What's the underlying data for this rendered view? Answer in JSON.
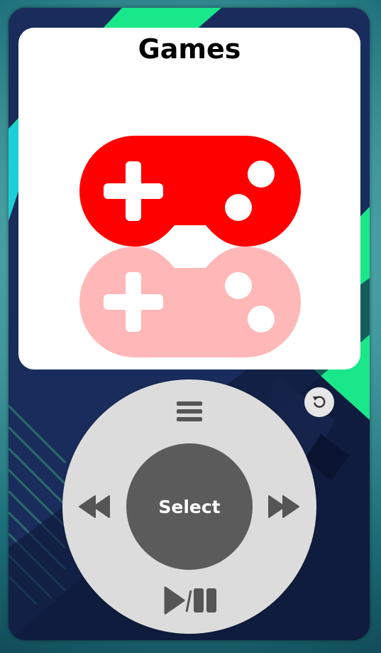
{
  "screen": {
    "title": "Games",
    "icon": "gamepad-icon",
    "icon_color": "#ff0000"
  },
  "controls": {
    "menu_icon": "menu-icon",
    "prev_icon": "rewind-icon",
    "next_icon": "fast-forward-icon",
    "play_pause_icon": "play-pause-icon",
    "center_label": "Select",
    "reset_icon": "reset-icon"
  },
  "colors": {
    "wheel": "#dcdcdc",
    "center_button": "#5b5b5b",
    "control_icons": "#555555",
    "wallpaper_base": "#0f1c3d",
    "wallpaper_accent": "#19e78a"
  }
}
